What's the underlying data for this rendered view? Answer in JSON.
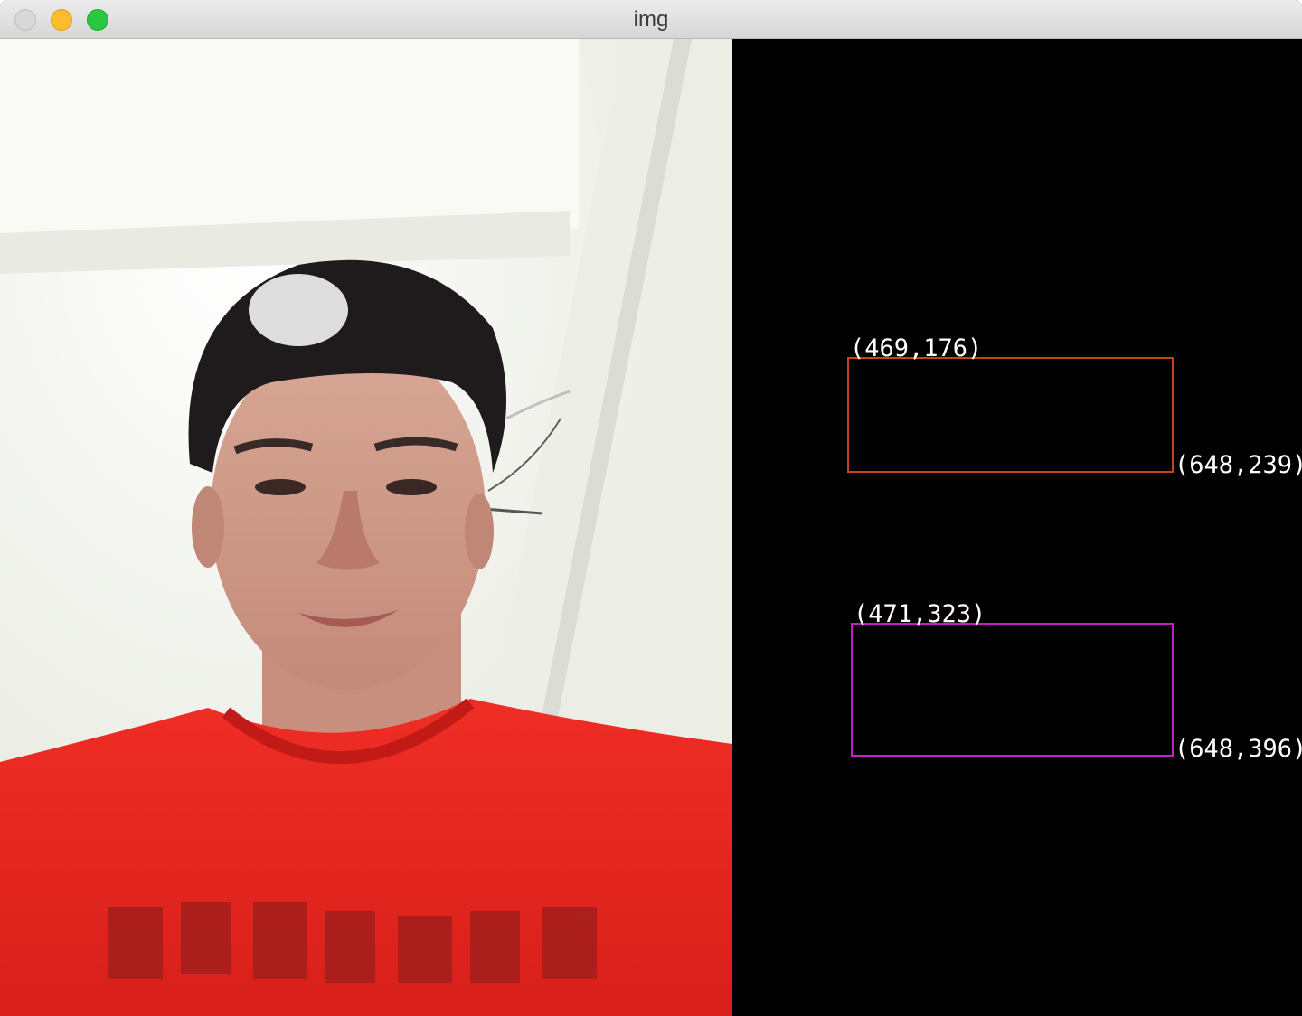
{
  "window": {
    "title": "img"
  },
  "canvas": {
    "background": "#000000",
    "rects": [
      {
        "name": "orange-rect",
        "color": "#c8431b",
        "top_left_label": "(469,176)",
        "bottom_right_label": "(648,239)"
      },
      {
        "name": "magenta-rect",
        "color": "#c21ec4",
        "top_left_label": "(471,323)",
        "bottom_right_label": "(648,396)"
      }
    ]
  },
  "colors": {
    "shirt": "#e3261f",
    "wall": "#f4f6f0"
  }
}
